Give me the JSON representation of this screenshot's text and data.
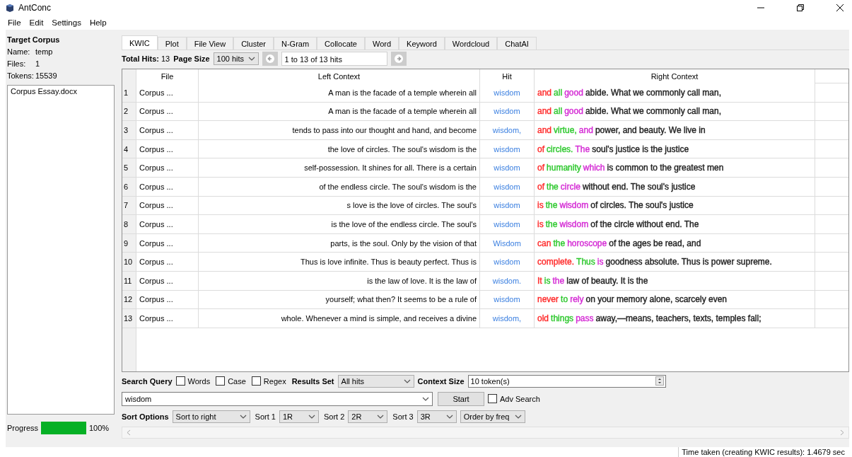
{
  "window": {
    "title": "AntConc"
  },
  "menu": [
    "File",
    "Edit",
    "Settings",
    "Help"
  ],
  "sidebar": {
    "heading": "Target Corpus",
    "fields": [
      {
        "label": "Name:",
        "value": "temp"
      },
      {
        "label": "Files:",
        "value": "1"
      },
      {
        "label": "Tokens:",
        "value": "15539"
      }
    ],
    "files": [
      "Corpus Essay.docx"
    ],
    "progress": {
      "label": "Progress",
      "level": 1,
      "reading": "100%"
    }
  },
  "tabs": [
    {
      "label": "KWIC",
      "selected": true
    },
    {
      "label": "Plot",
      "selected": false
    },
    {
      "label": "File View",
      "selected": false
    },
    {
      "label": "Cluster",
      "selected": false
    },
    {
      "label": "N-Gram",
      "selected": false
    },
    {
      "label": "Collocate",
      "selected": false
    },
    {
      "label": "Word",
      "selected": false
    },
    {
      "label": "Keyword",
      "selected": false
    },
    {
      "label": "Wordcloud",
      "selected": false
    },
    {
      "label": "ChatAI",
      "selected": false
    }
  ],
  "toolbar": {
    "total_hits_label": "Total Hits:",
    "total_hits": "13",
    "page_size_label": "Page Size",
    "page_size": "100 hits",
    "range": "1 to 13 of 13 hits"
  },
  "table": {
    "columns": [
      "File",
      "Left Context",
      "Hit",
      "Right Context"
    ],
    "rows": [
      {
        "number": "1",
        "file": "Corpus ...",
        "left": "A man is the facade of a temple wherein all",
        "hit": "wisdom",
        "right": [
          {
            "text": "and",
            "color": "#ff2a2a"
          },
          {
            "text": "all",
            "color": "#2ec82e"
          },
          {
            "text": "good",
            "color": "#d42ad4"
          },
          {
            "text": "abide. What we commonly call man,"
          }
        ]
      },
      {
        "number": "2",
        "file": "Corpus ...",
        "left": "A man is the facade of a temple wherein all",
        "hit": "wisdom",
        "right": [
          {
            "text": "and",
            "color": "#ff2a2a"
          },
          {
            "text": "all",
            "color": "#2ec82e"
          },
          {
            "text": "good",
            "color": "#d42ad4"
          },
          {
            "text": "abide. What we commonly call man,"
          }
        ]
      },
      {
        "number": "3",
        "file": "Corpus ...",
        "left": "tends to pass into our thought and hand, and become",
        "hit": "wisdom,",
        "right": [
          {
            "text": "and",
            "color": "#ff2a2a"
          },
          {
            "text": "virtue,",
            "color": "#2ec82e"
          },
          {
            "text": "and",
            "color": "#d42ad4"
          },
          {
            "text": "power, and beauty. We live in"
          }
        ]
      },
      {
        "number": "4",
        "file": "Corpus ...",
        "left": "the love of circles. The soul's wisdom is the",
        "hit": "wisdom",
        "right": [
          {
            "text": "of",
            "color": "#ff2a2a"
          },
          {
            "text": "circles.",
            "color": "#2ec82e"
          },
          {
            "text": "The",
            "color": "#d42ad4"
          },
          {
            "text": "soul's justice is the justice"
          }
        ]
      },
      {
        "number": "5",
        "file": "Corpus ...",
        "left": "self-possession. It shines for all. There is a certain",
        "hit": "wisdom",
        "right": [
          {
            "text": "of",
            "color": "#ff2a2a"
          },
          {
            "text": "humanity",
            "color": "#2ec82e"
          },
          {
            "text": "which",
            "color": "#d42ad4"
          },
          {
            "text": "is common to the greatest men"
          }
        ]
      },
      {
        "number": "6",
        "file": "Corpus ...",
        "left": "of the endless circle. The soul's wisdom is the",
        "hit": "wisdom",
        "right": [
          {
            "text": "of",
            "color": "#ff2a2a"
          },
          {
            "text": "the",
            "color": "#2ec82e"
          },
          {
            "text": "circle",
            "color": "#d42ad4"
          },
          {
            "text": "without end. The soul's justice"
          }
        ]
      },
      {
        "number": "7",
        "file": "Corpus ...",
        "left": "s love is the love of circles. The soul's",
        "hit": "wisdom",
        "right": [
          {
            "text": "is",
            "color": "#ff2a2a"
          },
          {
            "text": "the",
            "color": "#2ec82e"
          },
          {
            "text": "wisdom",
            "color": "#d42ad4"
          },
          {
            "text": "of circles. The soul's justice"
          }
        ]
      },
      {
        "number": "8",
        "file": "Corpus ...",
        "left": "is the love of the endless circle. The soul's",
        "hit": "wisdom",
        "right": [
          {
            "text": "is",
            "color": "#ff2a2a"
          },
          {
            "text": "the",
            "color": "#2ec82e"
          },
          {
            "text": "wisdom",
            "color": "#d42ad4"
          },
          {
            "text": "of the circle without end. The"
          }
        ]
      },
      {
        "number": "9",
        "file": "Corpus ...",
        "left": "parts, is the soul. Only by the vision of that",
        "hit": "Wisdom",
        "right": [
          {
            "text": "can",
            "color": "#ff2a2a"
          },
          {
            "text": "the",
            "color": "#2ec82e"
          },
          {
            "text": "horoscope",
            "color": "#d42ad4"
          },
          {
            "text": "of the ages be read, and"
          }
        ]
      },
      {
        "number": "10",
        "file": "Corpus ...",
        "left": "Thus is love infinite. Thus is beauty perfect. Thus is",
        "hit": "wisdom",
        "right": [
          {
            "text": "complete.",
            "color": "#ff2a2a"
          },
          {
            "text": "Thus",
            "color": "#2ec82e"
          },
          {
            "text": "is",
            "color": "#d42ad4"
          },
          {
            "text": "goodness absolute. Thus is power supreme."
          }
        ]
      },
      {
        "number": "11",
        "file": "Corpus ...",
        "left": "is the law of love. It is the law of",
        "hit": "wisdom.",
        "right": [
          {
            "text": "It",
            "color": "#ff2a2a"
          },
          {
            "text": "is",
            "color": "#2ec82e"
          },
          {
            "text": "the",
            "color": "#d42ad4"
          },
          {
            "text": "law of beauty. It is the"
          }
        ]
      },
      {
        "number": "12",
        "file": "Corpus ...",
        "left": "yourself; what then? It seems to be a rule of",
        "hit": "wisdom",
        "right": [
          {
            "text": "never",
            "color": "#ff2a2a"
          },
          {
            "text": "to",
            "color": "#2ec82e"
          },
          {
            "text": "rely",
            "color": "#d42ad4"
          },
          {
            "text": "on your memory alone, scarcely even"
          }
        ]
      },
      {
        "number": "13",
        "file": "Corpus ...",
        "left": "whole. Whenever a mind is simple, and receives a divine",
        "hit": "wisdom,",
        "right": [
          {
            "text": "old",
            "color": "#ff2a2a"
          },
          {
            "text": "things",
            "color": "#2ec82e"
          },
          {
            "text": "pass",
            "color": "#d42ad4"
          },
          {
            "text": "away,—means, teachers, texts, temples fall;"
          }
        ]
      }
    ]
  },
  "search": {
    "query_label": "Search Query",
    "options": [
      {
        "label": "Words",
        "checked": false
      },
      {
        "label": "Case",
        "checked": false
      },
      {
        "label": "Regex",
        "checked": false
      }
    ],
    "results_set_label": "Results Set",
    "results_set": "All hits",
    "context_size_label": "Context Size",
    "context_size": "10 token(s)",
    "query": "wisdom",
    "start": "Start",
    "adv_search": {
      "label": "Adv Search",
      "checked": false
    }
  },
  "sort": {
    "label": "Sort Options",
    "mode": "Sort to right",
    "levels": [
      {
        "label": "Sort 1",
        "value": "1R"
      },
      {
        "label": "Sort 2",
        "value": "2R"
      },
      {
        "label": "Sort 3",
        "value": "3R"
      }
    ],
    "order": "Order by freq"
  },
  "status_bar": "Time taken (creating KWIC results): 1.4679 sec"
}
